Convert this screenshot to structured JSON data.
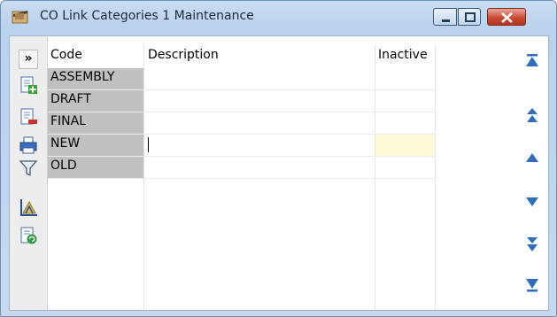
{
  "window": {
    "title": "CO Link Categories 1 Maintenance",
    "buttons": {
      "minimize": "minimize-icon",
      "maximize": "maximize-icon",
      "close": "close-icon"
    }
  },
  "toolbar": {
    "expand_label": "»",
    "icons": [
      "add-record-icon",
      "delete-record-icon",
      "print-icon",
      "filter-icon",
      "report-icon",
      "refresh-icon"
    ]
  },
  "grid": {
    "columns": {
      "code": "Code",
      "description": "Description",
      "inactive": "Inactive"
    },
    "rows": [
      {
        "code": "ASSEMBLY",
        "description": ""
      },
      {
        "code": "DRAFT",
        "description": ""
      },
      {
        "code": "FINAL",
        "description": ""
      },
      {
        "code": "NEW",
        "description": ""
      },
      {
        "code": "OLD",
        "description": ""
      }
    ],
    "active_row": "NEW"
  },
  "navigation": [
    "first-record-icon",
    "page-up-icon",
    "previous-record-icon",
    "next-record-icon",
    "page-down-icon",
    "last-record-icon"
  ],
  "colors": {
    "title_bar": "#bad2ee",
    "code_cell": "#c0c0c0",
    "active_inactive_cell": "#fffbd6",
    "nav_arrow": "#2f6dbf",
    "close_button": "#c8452d"
  }
}
